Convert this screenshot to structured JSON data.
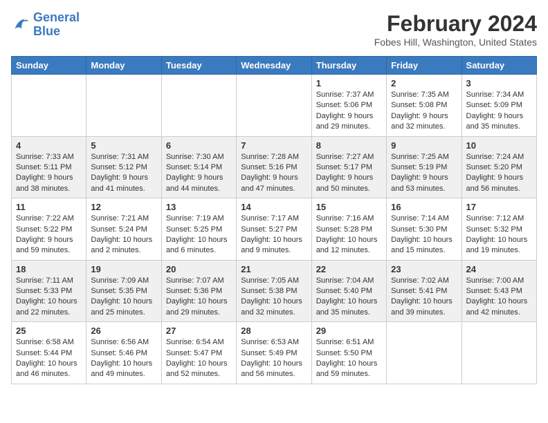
{
  "header": {
    "logo_line1": "General",
    "logo_line2": "Blue",
    "title": "February 2024",
    "subtitle": "Fobes Hill, Washington, United States"
  },
  "days_of_week": [
    "Sunday",
    "Monday",
    "Tuesday",
    "Wednesday",
    "Thursday",
    "Friday",
    "Saturday"
  ],
  "weeks": [
    [
      {
        "day": "",
        "sunrise": "",
        "sunset": "",
        "daylight": ""
      },
      {
        "day": "",
        "sunrise": "",
        "sunset": "",
        "daylight": ""
      },
      {
        "day": "",
        "sunrise": "",
        "sunset": "",
        "daylight": ""
      },
      {
        "day": "",
        "sunrise": "",
        "sunset": "",
        "daylight": ""
      },
      {
        "day": "1",
        "sunrise": "Sunrise: 7:37 AM",
        "sunset": "Sunset: 5:06 PM",
        "daylight": "Daylight: 9 hours and 29 minutes."
      },
      {
        "day": "2",
        "sunrise": "Sunrise: 7:35 AM",
        "sunset": "Sunset: 5:08 PM",
        "daylight": "Daylight: 9 hours and 32 minutes."
      },
      {
        "day": "3",
        "sunrise": "Sunrise: 7:34 AM",
        "sunset": "Sunset: 5:09 PM",
        "daylight": "Daylight: 9 hours and 35 minutes."
      }
    ],
    [
      {
        "day": "4",
        "sunrise": "Sunrise: 7:33 AM",
        "sunset": "Sunset: 5:11 PM",
        "daylight": "Daylight: 9 hours and 38 minutes."
      },
      {
        "day": "5",
        "sunrise": "Sunrise: 7:31 AM",
        "sunset": "Sunset: 5:12 PM",
        "daylight": "Daylight: 9 hours and 41 minutes."
      },
      {
        "day": "6",
        "sunrise": "Sunrise: 7:30 AM",
        "sunset": "Sunset: 5:14 PM",
        "daylight": "Daylight: 9 hours and 44 minutes."
      },
      {
        "day": "7",
        "sunrise": "Sunrise: 7:28 AM",
        "sunset": "Sunset: 5:16 PM",
        "daylight": "Daylight: 9 hours and 47 minutes."
      },
      {
        "day": "8",
        "sunrise": "Sunrise: 7:27 AM",
        "sunset": "Sunset: 5:17 PM",
        "daylight": "Daylight: 9 hours and 50 minutes."
      },
      {
        "day": "9",
        "sunrise": "Sunrise: 7:25 AM",
        "sunset": "Sunset: 5:19 PM",
        "daylight": "Daylight: 9 hours and 53 minutes."
      },
      {
        "day": "10",
        "sunrise": "Sunrise: 7:24 AM",
        "sunset": "Sunset: 5:20 PM",
        "daylight": "Daylight: 9 hours and 56 minutes."
      }
    ],
    [
      {
        "day": "11",
        "sunrise": "Sunrise: 7:22 AM",
        "sunset": "Sunset: 5:22 PM",
        "daylight": "Daylight: 9 hours and 59 minutes."
      },
      {
        "day": "12",
        "sunrise": "Sunrise: 7:21 AM",
        "sunset": "Sunset: 5:24 PM",
        "daylight": "Daylight: 10 hours and 2 minutes."
      },
      {
        "day": "13",
        "sunrise": "Sunrise: 7:19 AM",
        "sunset": "Sunset: 5:25 PM",
        "daylight": "Daylight: 10 hours and 6 minutes."
      },
      {
        "day": "14",
        "sunrise": "Sunrise: 7:17 AM",
        "sunset": "Sunset: 5:27 PM",
        "daylight": "Daylight: 10 hours and 9 minutes."
      },
      {
        "day": "15",
        "sunrise": "Sunrise: 7:16 AM",
        "sunset": "Sunset: 5:28 PM",
        "daylight": "Daylight: 10 hours and 12 minutes."
      },
      {
        "day": "16",
        "sunrise": "Sunrise: 7:14 AM",
        "sunset": "Sunset: 5:30 PM",
        "daylight": "Daylight: 10 hours and 15 minutes."
      },
      {
        "day": "17",
        "sunrise": "Sunrise: 7:12 AM",
        "sunset": "Sunset: 5:32 PM",
        "daylight": "Daylight: 10 hours and 19 minutes."
      }
    ],
    [
      {
        "day": "18",
        "sunrise": "Sunrise: 7:11 AM",
        "sunset": "Sunset: 5:33 PM",
        "daylight": "Daylight: 10 hours and 22 minutes."
      },
      {
        "day": "19",
        "sunrise": "Sunrise: 7:09 AM",
        "sunset": "Sunset: 5:35 PM",
        "daylight": "Daylight: 10 hours and 25 minutes."
      },
      {
        "day": "20",
        "sunrise": "Sunrise: 7:07 AM",
        "sunset": "Sunset: 5:36 PM",
        "daylight": "Daylight: 10 hours and 29 minutes."
      },
      {
        "day": "21",
        "sunrise": "Sunrise: 7:05 AM",
        "sunset": "Sunset: 5:38 PM",
        "daylight": "Daylight: 10 hours and 32 minutes."
      },
      {
        "day": "22",
        "sunrise": "Sunrise: 7:04 AM",
        "sunset": "Sunset: 5:40 PM",
        "daylight": "Daylight: 10 hours and 35 minutes."
      },
      {
        "day": "23",
        "sunrise": "Sunrise: 7:02 AM",
        "sunset": "Sunset: 5:41 PM",
        "daylight": "Daylight: 10 hours and 39 minutes."
      },
      {
        "day": "24",
        "sunrise": "Sunrise: 7:00 AM",
        "sunset": "Sunset: 5:43 PM",
        "daylight": "Daylight: 10 hours and 42 minutes."
      }
    ],
    [
      {
        "day": "25",
        "sunrise": "Sunrise: 6:58 AM",
        "sunset": "Sunset: 5:44 PM",
        "daylight": "Daylight: 10 hours and 46 minutes."
      },
      {
        "day": "26",
        "sunrise": "Sunrise: 6:56 AM",
        "sunset": "Sunset: 5:46 PM",
        "daylight": "Daylight: 10 hours and 49 minutes."
      },
      {
        "day": "27",
        "sunrise": "Sunrise: 6:54 AM",
        "sunset": "Sunset: 5:47 PM",
        "daylight": "Daylight: 10 hours and 52 minutes."
      },
      {
        "day": "28",
        "sunrise": "Sunrise: 6:53 AM",
        "sunset": "Sunset: 5:49 PM",
        "daylight": "Daylight: 10 hours and 56 minutes."
      },
      {
        "day": "29",
        "sunrise": "Sunrise: 6:51 AM",
        "sunset": "Sunset: 5:50 PM",
        "daylight": "Daylight: 10 hours and 59 minutes."
      },
      {
        "day": "",
        "sunrise": "",
        "sunset": "",
        "daylight": ""
      },
      {
        "day": "",
        "sunrise": "",
        "sunset": "",
        "daylight": ""
      }
    ]
  ]
}
